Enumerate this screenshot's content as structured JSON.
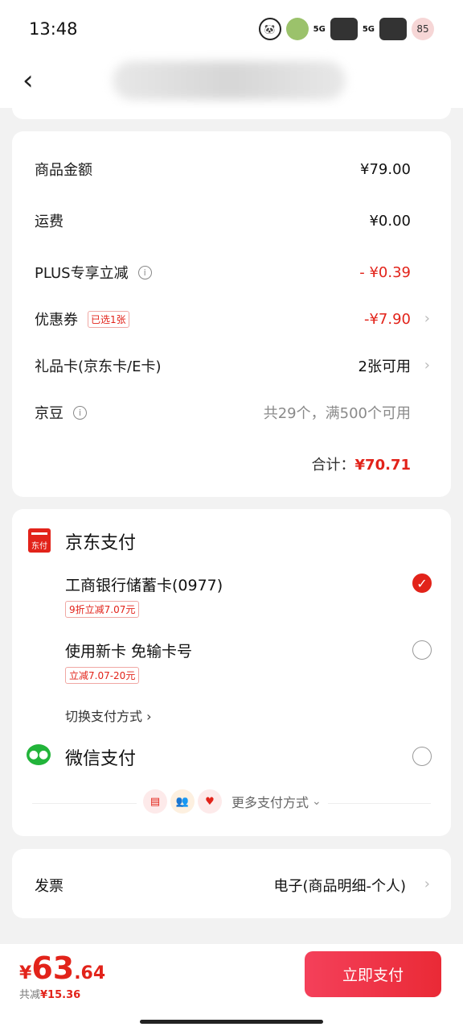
{
  "status": {
    "time": "13:48",
    "battery": "85",
    "sig1": "5G",
    "sig2": "5G"
  },
  "nav": {
    "back_glyph": "‹"
  },
  "amounts": {
    "goods_label": "商品金额",
    "goods_value": "¥79.00",
    "shipping_label": "运费",
    "shipping_value": "¥0.00",
    "plus_label": "PLUS专享立减",
    "plus_value": "- ¥0.39",
    "coupon_label": "优惠券",
    "coupon_badge": "已选1张",
    "coupon_value": "-¥7.90",
    "giftcard_label": "礼品卡(京东卡/E卡)",
    "giftcard_value": "2张可用",
    "beans_label": "京豆",
    "beans_value": "共29个，满500个可用",
    "total_label": "合计：",
    "total_value": "¥70.71"
  },
  "payment": {
    "jd_title": "京东支付",
    "jd_logo_text": "东付",
    "bank_title": "工商银行储蓄卡(0977)",
    "bank_badge": "9折立减7.07元",
    "newcard_title": "使用新卡 免输卡号",
    "newcard_badge": "立减7.07-20元",
    "switch_label": "切换支付方式",
    "wechat_title": "微信支付",
    "more_label": "更多支付方式"
  },
  "invoice": {
    "label": "发票",
    "value": "电子(商品明细-个人)"
  },
  "bottom": {
    "currency": "¥",
    "price_int": "63",
    "price_dec": ".64",
    "saving_label": "共减",
    "saving_value": "¥15.36",
    "pay_button": "立即支付"
  },
  "colors": {
    "accent": "#e2231a",
    "wechat": "#22b43a"
  }
}
